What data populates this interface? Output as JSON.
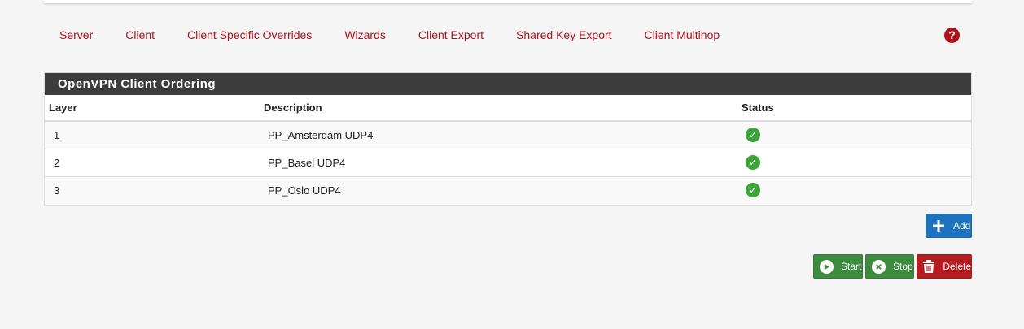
{
  "tabs": [
    "Server",
    "Client",
    "Client Specific Overrides",
    "Wizards",
    "Client Export",
    "Shared Key Export",
    "Client Multihop"
  ],
  "help_icon": "question-circle-icon",
  "panel": {
    "title": "OpenVPN Client Ordering",
    "columns": {
      "layer": "Layer",
      "description": "Description",
      "status": "Status"
    },
    "rows": [
      {
        "layer": "1",
        "description": "PP_Amsterdam UDP4",
        "status": "ok"
      },
      {
        "layer": "2",
        "description": "PP_Basel UDP4",
        "status": "ok"
      },
      {
        "layer": "3",
        "description": "PP_Oslo UDP4",
        "status": "ok"
      }
    ]
  },
  "buttons": {
    "add": "Add",
    "start": "Start",
    "stop": "Stop",
    "delete": "Delete"
  },
  "colors": {
    "link": "#b0121b",
    "panel_header": "#3c3c3c",
    "primary": "#1e73be",
    "success": "#3d8b3d",
    "danger": "#b41c20",
    "status_ok": "#3da33a"
  }
}
